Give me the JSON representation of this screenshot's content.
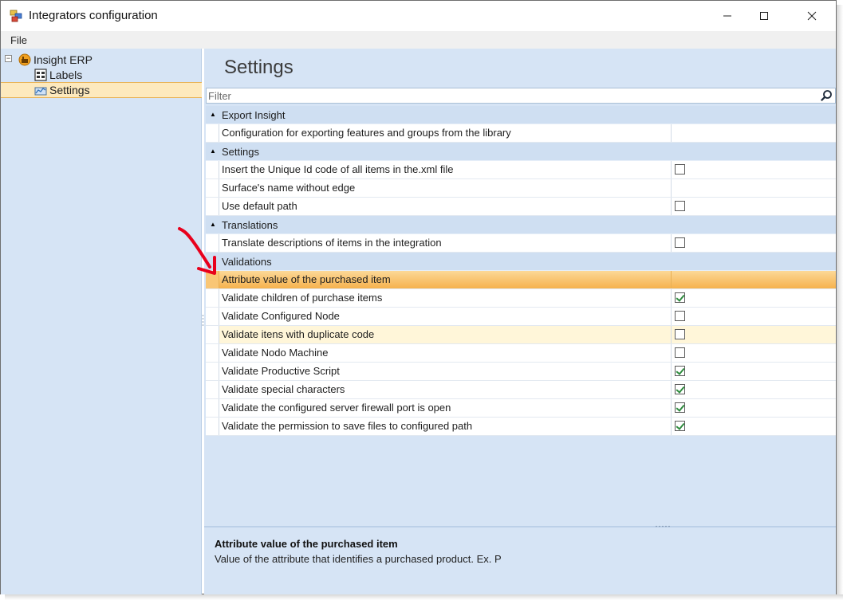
{
  "window": {
    "title": "Integrators configuration"
  },
  "menu": {
    "items": [
      "File"
    ]
  },
  "tree": {
    "root": {
      "label": "Insight ERP",
      "icon": "erp-icon"
    },
    "children": [
      {
        "label": "Labels",
        "icon": "labels-icon",
        "selected": false
      },
      {
        "label": "Settings",
        "icon": "settings-icon",
        "selected": true
      }
    ]
  },
  "settings": {
    "heading": "Settings",
    "filter_placeholder": "Filter",
    "categories": [
      {
        "label": "Export Insight",
        "collapsible": true,
        "items": [
          {
            "name": "Configuration for exporting features and groups from the library",
            "type": "text",
            "checked": null
          }
        ]
      },
      {
        "label": "Settings",
        "collapsible": true,
        "items": [
          {
            "name": "Insert the Unique Id code of all items in the.xml file",
            "type": "checkbox",
            "checked": false
          },
          {
            "name": "Surface's name without edge",
            "type": "text",
            "checked": null
          },
          {
            "name": "Use default path",
            "type": "checkbox",
            "checked": false
          }
        ]
      },
      {
        "label": "Translations",
        "collapsible": true,
        "items": [
          {
            "name": "Translate descriptions of items in the integration",
            "type": "checkbox",
            "checked": false
          }
        ]
      },
      {
        "label": "Validations",
        "collapsible": false,
        "items": [
          {
            "name": "Attribute value of the purchased item",
            "type": "text",
            "checked": null,
            "state": "selected"
          },
          {
            "name": "Validate children of purchase items",
            "type": "checkbox",
            "checked": true
          },
          {
            "name": "Validate Configured Node",
            "type": "checkbox",
            "checked": false
          },
          {
            "name": "Validate itens with duplicate code",
            "type": "checkbox",
            "checked": false,
            "state": "hover"
          },
          {
            "name": "Validate Nodo Machine",
            "type": "checkbox",
            "checked": false
          },
          {
            "name": "Validate Productive Script",
            "type": "checkbox",
            "checked": true
          },
          {
            "name": "Validate special characters",
            "type": "checkbox",
            "checked": true
          },
          {
            "name": "Validate the configured server firewall port is open",
            "type": "checkbox",
            "checked": true
          },
          {
            "name": "Validate the permission to save files to configured path",
            "type": "checkbox",
            "checked": true
          }
        ]
      }
    ]
  },
  "help": {
    "title": "Attribute value of the purchased item",
    "description": "Value of the attribute that identifies a purchased product. Ex. P"
  },
  "colors": {
    "panel_bg": "#d6e4f5",
    "category_bg": "#cfdff2",
    "selection": "#f6b24d",
    "annotation_arrow": "#e8001c"
  }
}
